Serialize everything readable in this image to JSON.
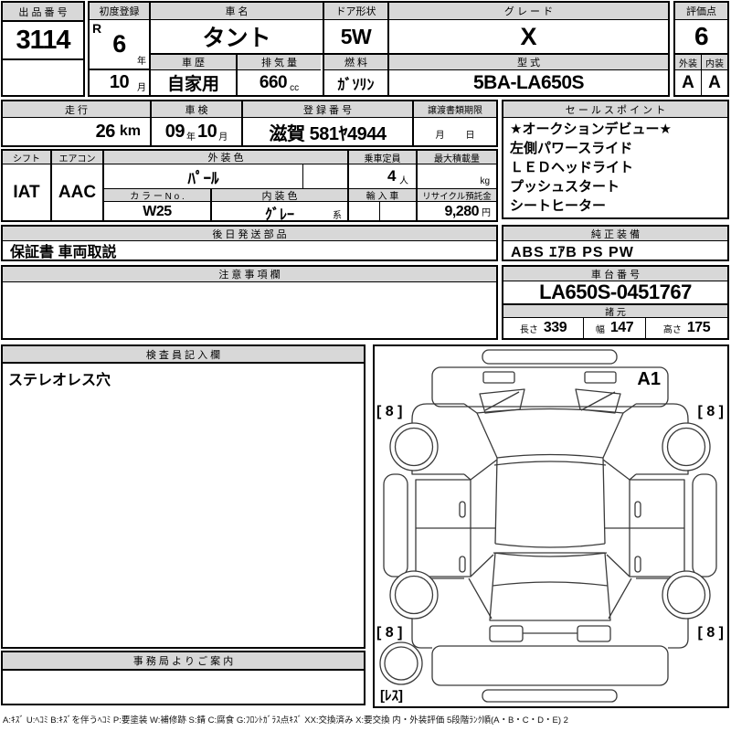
{
  "auction": {
    "label": "出 品 番 号",
    "number": "3114"
  },
  "first_reg": {
    "label": "初度登録",
    "era": "R",
    "year": "6",
    "year_suffix": "年",
    "month": "10",
    "month_suffix": "月"
  },
  "car": {
    "name_label": "車 名",
    "name": "タント",
    "door_label": "ドア形状",
    "door": "5W",
    "grade_label": "グ レ ー ド",
    "grade": "X",
    "history_label": "車 歴",
    "history": "自家用",
    "displacement_label": "排 気 量",
    "displacement": "660",
    "displacement_unit": "cc",
    "fuel_label": "燃 料",
    "fuel": "ｶﾞｿﾘﾝ",
    "model_label": "型 式",
    "model": "5BA-LA650S"
  },
  "score": {
    "label": "評価点",
    "value": "6",
    "exterior_label": "外装",
    "exterior": "A",
    "interior_label": "内装",
    "interior": "A"
  },
  "mileage": {
    "label": "走 行",
    "value": "26",
    "unit": "km"
  },
  "shaken": {
    "label": "車 検",
    "year": "09",
    "year_suffix": "年",
    "month": "10",
    "month_suffix": "月"
  },
  "reg_no": {
    "label": "登 録 番 号",
    "value": "滋賀 581ﾔ4944"
  },
  "transfer_docs": {
    "label": "譲渡書類期限",
    "month_suffix": "月",
    "day_suffix": "日"
  },
  "sales_points": {
    "label": "セ ー ル ス ポ イ ン ト",
    "items": [
      "★オークションデビュー★",
      "左側パワースライド",
      "ＬＥＤヘッドライト",
      "プッシュスタート",
      "シートヒーター"
    ]
  },
  "shift": {
    "label": "シフト",
    "value": "IAT"
  },
  "aircon": {
    "label": "エアコン",
    "value": "AAC"
  },
  "ext_color": {
    "label": "外 装 色",
    "value": "ﾊﾟｰﾙ"
  },
  "capacity": {
    "label": "乗車定員",
    "value": "4",
    "unit": "人"
  },
  "max_load": {
    "label": "最大積載量",
    "value": "",
    "unit": "kg"
  },
  "color_no": {
    "label": "カ ラ ー N o .",
    "value": "W25"
  },
  "int_color": {
    "label": "内 装 色",
    "value": "ｸﾞﾚｰ",
    "suffix": "系"
  },
  "import_car": {
    "label": "輸 入 車",
    "value": ""
  },
  "recycle": {
    "label": "リサイクル預託金",
    "value": "9,280",
    "unit": "円"
  },
  "later_parts": {
    "label": "後 日 発 送 部 品",
    "value": "保証書 車両取説"
  },
  "equipment": {
    "label": "純 正 装 備",
    "value": "ABS ｴｱB PS PW"
  },
  "caution": {
    "label": "注 意 事 項 欄",
    "value": ""
  },
  "chassis": {
    "label": "車 台 番 号",
    "value": "LA650S-0451767"
  },
  "specs": {
    "label": "諸 元",
    "length_label": "長さ",
    "length": "339",
    "width_label": "幅",
    "width": "147",
    "height_label": "高さ",
    "height": "175"
  },
  "inspector": {
    "label": "検 査 員 記 入 欄",
    "note": "ステレオレス穴"
  },
  "office": {
    "label": "事 務 局 よ り ご 案 内",
    "value": ""
  },
  "diagram": {
    "annotation": "A1",
    "tire_front_left": "[ 8 ]",
    "tire_front_right": "[ 8 ]",
    "tire_rear_left": "[ 8 ]",
    "tire_rear_right": "[ 8 ]",
    "spare_label": "[ﾚｽ]"
  },
  "legend": "A:ｷｽﾞ U:ﾍｺﾐ B:ｷｽﾞを伴うﾍｺﾐ P:要塗装 W:補修跡 S:錆 C:腐食 G:ﾌﾛﾝﾄｶﾞﾗｽ点ｷｽﾞ XX:交換済み X:要交換  内・外装評価 5段階ﾗﾝｸ順(A・B・C・D・E) 2",
  "colors": {
    "header_bg": "#d8d8d8",
    "border": "#000000",
    "line": "#3a3a3a"
  }
}
